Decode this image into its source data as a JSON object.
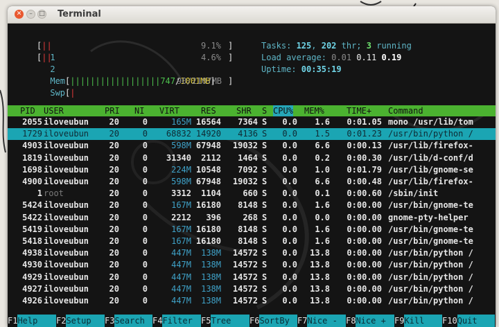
{
  "window": {
    "title": "Terminal"
  },
  "meters": {
    "cpu1": {
      "label": "1",
      "bar": "||",
      "pct": "9.1%"
    },
    "cpu2": {
      "label": "2",
      "bar": "||",
      "pct": "4.6%"
    },
    "mem": {
      "label": "Mem",
      "bar": "||||||||||||||||||",
      "used": "747",
      "total": "1001MB"
    },
    "swp": {
      "label": "Swp",
      "bar": "|",
      "value": "90/2107MB"
    }
  },
  "stats": {
    "tasks_label": "Tasks: ",
    "tasks": "125",
    "thr": "202",
    "thr_label": " thr; ",
    "running": "3",
    "running_label": " running",
    "load_label": "Load average: ",
    "load1": "0.01",
    "load5": "0.11",
    "load15": "0.19",
    "uptime_label": "Uptime: ",
    "uptime": "00:35:19"
  },
  "columns": [
    "PID",
    "USER",
    "PRI",
    "NI",
    "VIRT",
    "RES",
    "SHR",
    "S",
    "CPU%",
    "MEM%",
    "TIME+",
    "Command"
  ],
  "processes": [
    {
      "pid": "2055",
      "user": "iloveubun",
      "pri": "20",
      "ni": "0",
      "virt": "165M",
      "res": "16564",
      "shr": "7364",
      "s": "S",
      "cpu": "0.0",
      "mem": "1.6",
      "time": "0:01.05",
      "cmd": "mono /usr/lib/tom"
    },
    {
      "pid": "1729",
      "user": "iloveubun",
      "pri": "20",
      "ni": "0",
      "virt": "68832",
      "res": "14920",
      "shr": "4136",
      "s": "S",
      "cpu": "0.0",
      "mem": "1.5",
      "time": "0:01.23",
      "cmd": "/usr/bin/python /"
    },
    {
      "pid": "4903",
      "user": "iloveubun",
      "pri": "20",
      "ni": "0",
      "virt": "598M",
      "res": "67948",
      "shr": "19032",
      "s": "S",
      "cpu": "0.0",
      "mem": "6.6",
      "time": "0:00.13",
      "cmd": "/usr/lib/firefox-"
    },
    {
      "pid": "1819",
      "user": "iloveubun",
      "pri": "20",
      "ni": "0",
      "virt": "31340",
      "res": "2112",
      "shr": "1464",
      "s": "S",
      "cpu": "0.0",
      "mem": "0.2",
      "time": "0:00.30",
      "cmd": "/usr/lib/d-conf/d"
    },
    {
      "pid": "1698",
      "user": "iloveubun",
      "pri": "20",
      "ni": "0",
      "virt": "224M",
      "res": "10548",
      "shr": "7092",
      "s": "S",
      "cpu": "0.0",
      "mem": "1.0",
      "time": "0:01.79",
      "cmd": "/usr/lib/gnome-se"
    },
    {
      "pid": "4900",
      "user": "iloveubun",
      "pri": "20",
      "ni": "0",
      "virt": "598M",
      "res": "67948",
      "shr": "19032",
      "s": "S",
      "cpu": "0.0",
      "mem": "6.6",
      "time": "0:00.48",
      "cmd": "/usr/lib/firefox-"
    },
    {
      "pid": "1",
      "user": "root",
      "pri": "20",
      "ni": "0",
      "virt": "3312",
      "res": "1104",
      "shr": "660",
      "s": "S",
      "cpu": "0.0",
      "mem": "0.1",
      "time": "0:00.60",
      "cmd": "/sbin/init"
    },
    {
      "pid": "5424",
      "user": "iloveubun",
      "pri": "20",
      "ni": "0",
      "virt": "167M",
      "res": "16180",
      "shr": "8148",
      "s": "S",
      "cpu": "0.0",
      "mem": "1.6",
      "time": "0:00.00",
      "cmd": "/usr/bin/gnome-te"
    },
    {
      "pid": "5422",
      "user": "iloveubun",
      "pri": "20",
      "ni": "0",
      "virt": "2212",
      "res": "396",
      "shr": "268",
      "s": "S",
      "cpu": "0.0",
      "mem": "0.0",
      "time": "0:00.00",
      "cmd": "gnome-pty-helper"
    },
    {
      "pid": "5419",
      "user": "iloveubun",
      "pri": "20",
      "ni": "0",
      "virt": "167M",
      "res": "16180",
      "shr": "8148",
      "s": "S",
      "cpu": "0.0",
      "mem": "1.6",
      "time": "0:00.00",
      "cmd": "/usr/bin/gnome-te"
    },
    {
      "pid": "5418",
      "user": "iloveubun",
      "pri": "20",
      "ni": "0",
      "virt": "167M",
      "res": "16180",
      "shr": "8148",
      "s": "S",
      "cpu": "0.0",
      "mem": "1.6",
      "time": "0:00.00",
      "cmd": "/usr/bin/gnome-te"
    },
    {
      "pid": "4938",
      "user": "iloveubun",
      "pri": "20",
      "ni": "0",
      "virt": "447M",
      "res": "138M",
      "shr": "14572",
      "s": "S",
      "cpu": "0.0",
      "mem": "13.8",
      "time": "0:00.00",
      "cmd": "/usr/bin/python /"
    },
    {
      "pid": "4930",
      "user": "iloveubun",
      "pri": "20",
      "ni": "0",
      "virt": "447M",
      "res": "138M",
      "shr": "14572",
      "s": "S",
      "cpu": "0.0",
      "mem": "13.8",
      "time": "0:00.00",
      "cmd": "/usr/bin/python /"
    },
    {
      "pid": "4929",
      "user": "iloveubun",
      "pri": "20",
      "ni": "0",
      "virt": "447M",
      "res": "138M",
      "shr": "14572",
      "s": "S",
      "cpu": "0.0",
      "mem": "13.8",
      "time": "0:00.00",
      "cmd": "/usr/bin/python /"
    },
    {
      "pid": "4927",
      "user": "iloveubun",
      "pri": "20",
      "ni": "0",
      "virt": "447M",
      "res": "138M",
      "shr": "14572",
      "s": "S",
      "cpu": "0.0",
      "mem": "13.8",
      "time": "0:00.00",
      "cmd": "/usr/bin/python /"
    },
    {
      "pid": "4926",
      "user": "iloveubun",
      "pri": "20",
      "ni": "0",
      "virt": "447M",
      "res": "138M",
      "shr": "14572",
      "s": "S",
      "cpu": "0.0",
      "mem": "13.8",
      "time": "0:00.00",
      "cmd": "/usr/bin/python /"
    }
  ],
  "footer_keys": [
    {
      "key": "F1",
      "label": "Help"
    },
    {
      "key": "F2",
      "label": "Setup"
    },
    {
      "key": "F3",
      "label": "Search"
    },
    {
      "key": "F4",
      "label": "Filter"
    },
    {
      "key": "F5",
      "label": "Tree"
    },
    {
      "key": "F6",
      "label": "SortBy"
    },
    {
      "key": "F7",
      "label": "Nice -"
    },
    {
      "key": "F8",
      "label": "Nice +"
    },
    {
      "key": "F9",
      "label": "Kill"
    },
    {
      "key": "F10",
      "label": "Quit"
    }
  ],
  "colors": {
    "header": "#4bb230",
    "selection": "#1ba5b3",
    "background": "#141414"
  }
}
